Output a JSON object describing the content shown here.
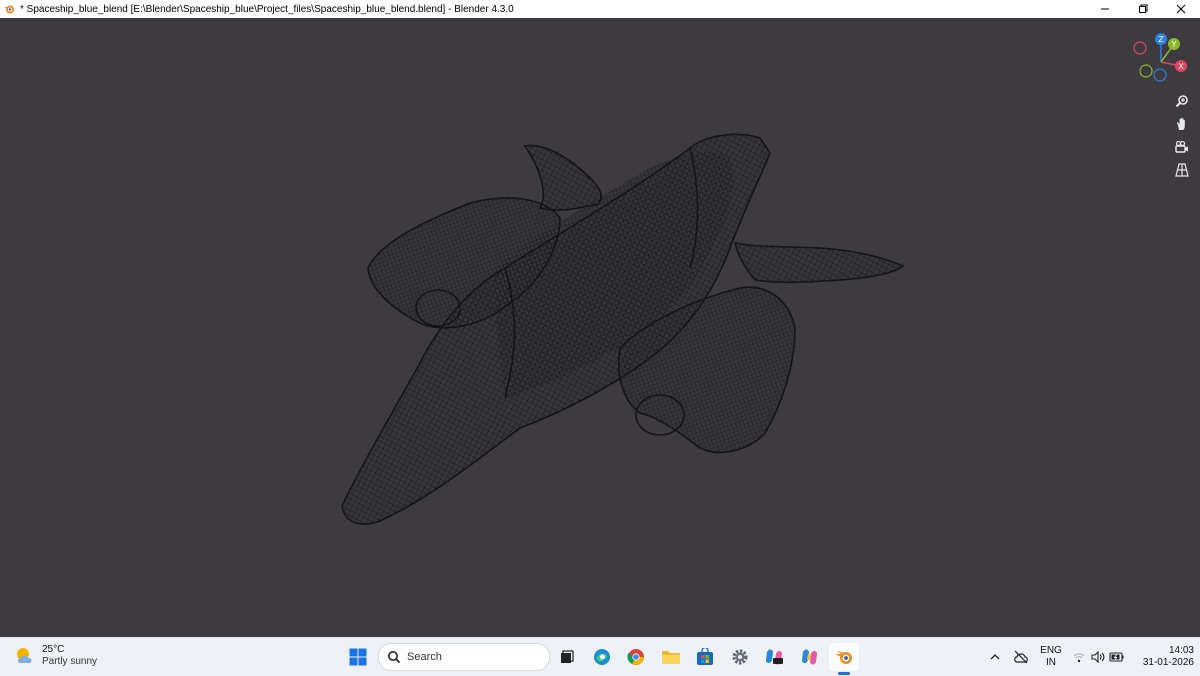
{
  "window": {
    "title": "* Spaceship_blue_blend [E:\\Blender\\Spaceship_blue\\Project_files\\Spaceship_blue_blend.blend] - Blender 4.3.0",
    "app_icon": "blender-icon",
    "controls": [
      "minimize-icon",
      "restore-icon",
      "close-icon"
    ]
  },
  "viewport": {
    "background": "#3d3b3f",
    "gizmo": {
      "z_label": "Z",
      "y_label": "Y",
      "x_label": "X",
      "colors": {
        "x": "#e0465e",
        "y": "#8ab92e",
        "z": "#2f7fe0"
      }
    },
    "tools": [
      "zoom-icon",
      "hand-pan-icon",
      "camera-icon",
      "grid-icon"
    ]
  },
  "taskbar": {
    "weather": {
      "temp": "25°C",
      "desc": "Partly sunny",
      "icon": "sun-cloud-icon"
    },
    "search_label": "Search",
    "apps": [
      "windows-start-icon",
      "task-view-icon",
      "edge-icon",
      "chrome-icon",
      "file-explorer-icon",
      "microsoft-store-icon",
      "settings-icon",
      "copilot-new-icon",
      "copilot-icon",
      "blender-icon"
    ],
    "tray": {
      "lang_line1": "ENG",
      "lang_line2": "IN",
      "time": "14:03",
      "date": "31-01-2026"
    }
  }
}
